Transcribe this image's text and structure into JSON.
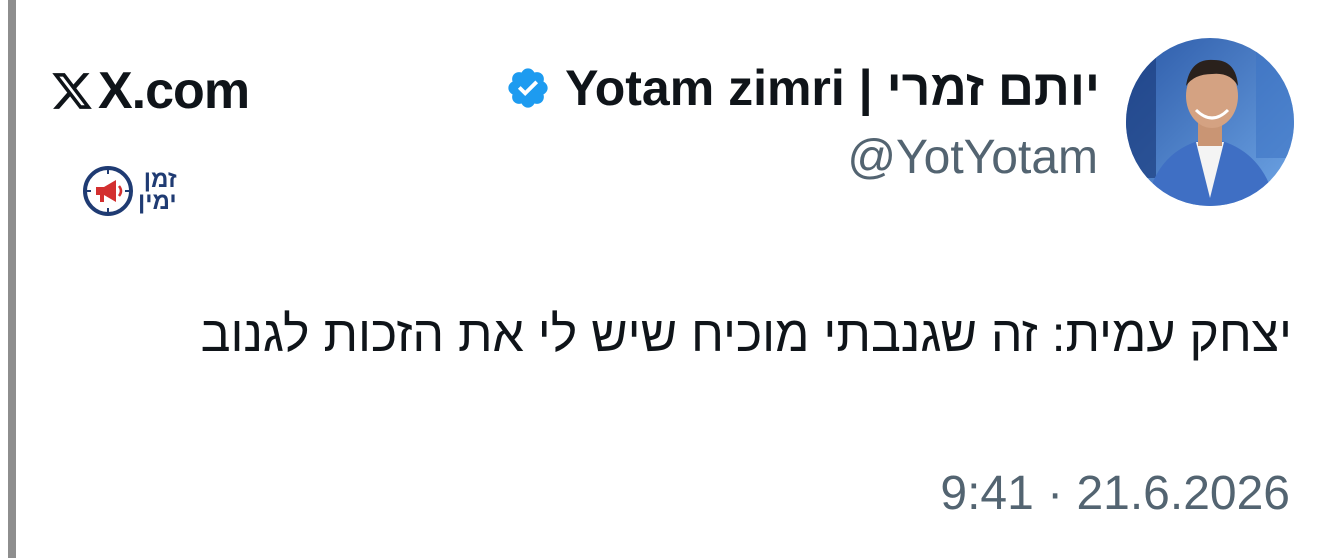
{
  "author": {
    "display_name": "Yotam zimri | יותם זמרי",
    "handle": "@YotYotam",
    "verified": true
  },
  "platform": {
    "name": "X.com",
    "icon": "x-logo-icon"
  },
  "brand": {
    "line1": "זמן",
    "line2": "ימין",
    "icon": "megaphone-clock-icon"
  },
  "tweet": {
    "text": "יצחק עמית: זה שגנבתי מוכיח שיש לי את הזכות לגנוב",
    "time": "9:41",
    "date": "21.6.2026",
    "timestamp": "9:41 · 21.6.2026"
  },
  "colors": {
    "verified_blue": "#1d9bf0",
    "text_primary": "#0f1419",
    "text_secondary": "#536471",
    "side_bar": "#8e8e8e",
    "brand_red": "#d32f2f",
    "brand_navy": "#1f3b73"
  }
}
